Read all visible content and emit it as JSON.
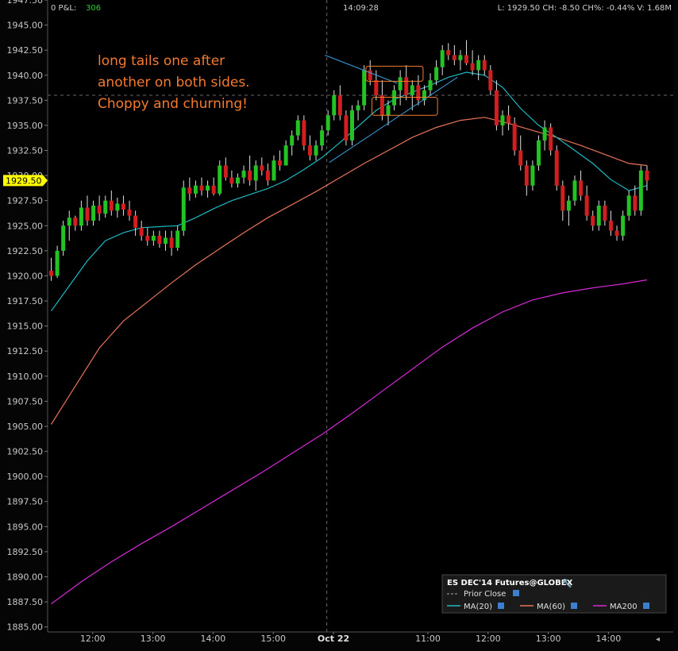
{
  "header": {
    "pnl_label": "0 P&L:",
    "pnl_value": "306",
    "time": "14:09:28",
    "quote": "L: 1929.50 CH: -8.50   CH%: -0.44% V: 1.68M"
  },
  "colors": {
    "background": "#050505",
    "up_candle": "#22c322",
    "down_candle": "#d21e1e",
    "wick": "#e0e0e0",
    "ma20": "#1fb8c0",
    "ma60": "#e8735a",
    "ma200": "#d62ad6",
    "annotation": "#f47a2e",
    "trend": "#3a9fe0",
    "price_tag": "#ffff00"
  },
  "annotation": {
    "lines": [
      "long tails one after",
      "another on both sides.",
      "Choppy and churning!"
    ]
  },
  "legend": {
    "title": "ES DEC'14 Futures@GLOBEX",
    "prior_close": "Prior Close",
    "ma20": "MA(20)",
    "ma60": "MA(60)",
    "ma200": "MA200"
  },
  "chart_data": {
    "type": "candlestick",
    "title": "",
    "xlabel": "",
    "ylabel": "",
    "ylim": [
      1884.5,
      1947.5
    ],
    "y_ticks": [
      "1947.50",
      "1945.00",
      "1942.50",
      "1940.00",
      "1937.50",
      "1935.00",
      "1932.50",
      "1930.00",
      "1927.50",
      "1925.00",
      "1922.50",
      "1920.00",
      "1917.50",
      "1915.00",
      "1912.50",
      "1910.00",
      "1907.50",
      "1905.00",
      "1902.50",
      "1900.00",
      "1897.50",
      "1895.00",
      "1892.50",
      "1890.00",
      "1887.50",
      "1885.00"
    ],
    "x_ticks": [
      {
        "label": "12:00",
        "bar": 6.9
      },
      {
        "label": "13:00",
        "bar": 16.9
      },
      {
        "label": "14:00",
        "bar": 26.9
      },
      {
        "label": "15:00",
        "bar": 36.9
      },
      {
        "label": "Oct 22",
        "bar": 46.9,
        "bold": true
      },
      {
        "label": "11:00",
        "bar": 62.6
      },
      {
        "label": "12:00",
        "bar": 72.6
      },
      {
        "label": "13:00",
        "bar": 82.6
      },
      {
        "label": "14:00",
        "bar": 92.6
      }
    ],
    "last_price": 1929.5,
    "prior_close": 1938.0,
    "session_divider_bar": 45.8,
    "candles": [
      [
        1920.5,
        1921.8,
        1919.5,
        1920.0
      ],
      [
        1920.0,
        1923.0,
        1919.8,
        1922.5
      ],
      [
        1922.5,
        1925.5,
        1922.0,
        1925.0
      ],
      [
        1925.0,
        1926.5,
        1923.5,
        1925.8
      ],
      [
        1925.8,
        1926.0,
        1924.5,
        1925.0
      ],
      [
        1925.0,
        1927.5,
        1924.5,
        1926.8
      ],
      [
        1926.8,
        1928.0,
        1925.0,
        1925.5
      ],
      [
        1925.5,
        1927.5,
        1925.0,
        1927.0
      ],
      [
        1927.0,
        1928.0,
        1925.5,
        1926.2
      ],
      [
        1926.2,
        1928.0,
        1925.8,
        1927.5
      ],
      [
        1927.5,
        1928.5,
        1926.0,
        1926.5
      ],
      [
        1926.5,
        1927.8,
        1925.8,
        1927.2
      ],
      [
        1927.2,
        1928.0,
        1926.0,
        1926.6
      ],
      [
        1926.6,
        1927.5,
        1925.5,
        1926.0
      ],
      [
        1926.0,
        1926.5,
        1924.0,
        1924.8
      ],
      [
        1924.8,
        1925.5,
        1923.5,
        1924.0
      ],
      [
        1924.0,
        1924.8,
        1923.0,
        1923.5
      ],
      [
        1923.5,
        1924.5,
        1923.0,
        1924.0
      ],
      [
        1924.0,
        1924.5,
        1922.8,
        1923.2
      ],
      [
        1923.2,
        1924.5,
        1922.5,
        1923.8
      ],
      [
        1923.8,
        1924.5,
        1922.0,
        1922.8
      ],
      [
        1922.8,
        1925.0,
        1922.5,
        1924.5
      ],
      [
        1924.5,
        1929.5,
        1924.0,
        1928.8
      ],
      [
        1928.8,
        1929.8,
        1927.5,
        1928.2
      ],
      [
        1928.2,
        1929.5,
        1927.8,
        1929.0
      ],
      [
        1929.0,
        1929.8,
        1928.0,
        1928.5
      ],
      [
        1928.5,
        1929.5,
        1927.8,
        1929.0
      ],
      [
        1929.0,
        1929.8,
        1928.0,
        1928.2
      ],
      [
        1928.2,
        1931.5,
        1928.0,
        1931.0
      ],
      [
        1931.0,
        1931.8,
        1929.5,
        1929.8
      ],
      [
        1929.8,
        1930.5,
        1928.8,
        1929.2
      ],
      [
        1929.2,
        1930.2,
        1928.8,
        1929.8
      ],
      [
        1929.8,
        1931.0,
        1929.2,
        1930.5
      ],
      [
        1930.5,
        1932.0,
        1929.0,
        1929.5
      ],
      [
        1929.5,
        1931.5,
        1928.5,
        1931.0
      ],
      [
        1931.0,
        1931.8,
        1930.0,
        1930.5
      ],
      [
        1930.5,
        1931.2,
        1929.0,
        1929.5
      ],
      [
        1929.5,
        1932.0,
        1929.5,
        1931.5
      ],
      [
        1931.5,
        1932.5,
        1930.5,
        1931.0
      ],
      [
        1931.0,
        1933.5,
        1931.0,
        1933.0
      ],
      [
        1933.0,
        1934.5,
        1932.0,
        1934.0
      ],
      [
        1934.0,
        1936.0,
        1933.5,
        1935.5
      ],
      [
        1935.5,
        1936.0,
        1932.5,
        1933.0
      ],
      [
        1933.0,
        1934.0,
        1931.5,
        1932.0
      ],
      [
        1932.0,
        1933.5,
        1931.5,
        1933.0
      ],
      [
        1933.0,
        1935.0,
        1932.5,
        1934.5
      ],
      [
        1934.5,
        1936.5,
        1934.0,
        1936.0
      ],
      [
        1936.0,
        1938.5,
        1935.5,
        1938.0
      ],
      [
        1938.0,
        1939.0,
        1935.5,
        1936.0
      ],
      [
        1936.0,
        1936.5,
        1933.0,
        1933.5
      ],
      [
        1933.5,
        1937.0,
        1933.0,
        1936.5
      ],
      [
        1936.5,
        1937.5,
        1935.5,
        1937.0
      ],
      [
        1937.0,
        1941.0,
        1936.5,
        1940.5
      ],
      [
        1940.5,
        1941.5,
        1939.0,
        1939.5
      ],
      [
        1939.5,
        1940.5,
        1937.5,
        1938.0
      ],
      [
        1938.0,
        1939.5,
        1935.5,
        1936.0
      ],
      [
        1936.0,
        1937.5,
        1935.0,
        1937.0
      ],
      [
        1937.0,
        1939.0,
        1936.5,
        1938.5
      ],
      [
        1938.5,
        1940.5,
        1937.0,
        1939.8
      ],
      [
        1939.8,
        1941.0,
        1937.5,
        1938.0
      ],
      [
        1938.0,
        1939.5,
        1936.5,
        1939.0
      ],
      [
        1939.0,
        1940.0,
        1937.0,
        1937.5
      ],
      [
        1937.5,
        1939.0,
        1937.0,
        1938.5
      ],
      [
        1938.5,
        1940.2,
        1938.0,
        1939.5
      ],
      [
        1939.5,
        1941.5,
        1939.0,
        1940.8
      ],
      [
        1940.8,
        1943.0,
        1940.0,
        1942.5
      ],
      [
        1942.5,
        1943.2,
        1941.5,
        1942.0
      ],
      [
        1942.0,
        1943.0,
        1941.0,
        1941.5
      ],
      [
        1941.5,
        1942.5,
        1940.5,
        1942.0
      ],
      [
        1942.0,
        1943.5,
        1941.0,
        1941.2
      ],
      [
        1941.2,
        1942.5,
        1940.0,
        1940.5
      ],
      [
        1940.5,
        1942.0,
        1939.5,
        1941.5
      ],
      [
        1941.5,
        1942.0,
        1940.0,
        1940.5
      ],
      [
        1940.5,
        1941.0,
        1938.0,
        1938.5
      ],
      [
        1938.5,
        1939.5,
        1934.5,
        1935.0
      ],
      [
        1935.0,
        1936.5,
        1934.0,
        1936.0
      ],
      [
        1936.0,
        1937.0,
        1934.5,
        1935.2
      ],
      [
        1935.2,
        1935.8,
        1932.0,
        1932.5
      ],
      [
        1932.5,
        1934.0,
        1930.5,
        1931.0
      ],
      [
        1931.0,
        1931.5,
        1928.0,
        1929.0
      ],
      [
        1929.0,
        1931.5,
        1928.5,
        1931.0
      ],
      [
        1931.0,
        1934.0,
        1930.5,
        1933.5
      ],
      [
        1933.5,
        1935.5,
        1932.5,
        1934.8
      ],
      [
        1934.8,
        1935.2,
        1932.0,
        1932.5
      ],
      [
        1932.5,
        1933.0,
        1928.5,
        1929.0
      ],
      [
        1929.0,
        1929.5,
        1925.5,
        1926.5
      ],
      [
        1926.5,
        1928.0,
        1925.0,
        1927.5
      ],
      [
        1927.5,
        1930.0,
        1927.0,
        1929.5
      ],
      [
        1929.5,
        1930.5,
        1927.5,
        1928.0
      ],
      [
        1928.0,
        1929.0,
        1925.5,
        1926.0
      ],
      [
        1926.0,
        1926.5,
        1924.5,
        1925.0
      ],
      [
        1925.0,
        1927.5,
        1924.5,
        1927.0
      ],
      [
        1927.0,
        1927.5,
        1925.0,
        1925.5
      ],
      [
        1925.5,
        1926.5,
        1924.0,
        1924.5
      ],
      [
        1924.5,
        1925.0,
        1923.5,
        1924.0
      ],
      [
        1924.0,
        1926.5,
        1923.5,
        1926.0
      ],
      [
        1926.0,
        1928.5,
        1925.5,
        1928.0
      ],
      [
        1928.0,
        1929.0,
        1926.0,
        1926.5
      ],
      [
        1926.5,
        1931.0,
        1926.0,
        1930.5
      ],
      [
        1930.5,
        1931.0,
        1928.5,
        1929.5
      ]
    ],
    "series": [
      {
        "name": "MA(20)",
        "bars": [
          0,
          3,
          6,
          9,
          12,
          15,
          18,
          21,
          24,
          27,
          30,
          33,
          36,
          39,
          42,
          45,
          48,
          51,
          54,
          57,
          60,
          63,
          66,
          69,
          72,
          75,
          78,
          81,
          84,
          87,
          90,
          93,
          96,
          99
        ],
        "values": [
          1916.5,
          1919.0,
          1921.5,
          1923.5,
          1924.3,
          1924.8,
          1924.9,
          1925.0,
          1925.8,
          1926.7,
          1927.5,
          1928.1,
          1928.7,
          1929.5,
          1930.6,
          1931.8,
          1933.3,
          1934.9,
          1936.5,
          1937.6,
          1938.3,
          1939.0,
          1939.8,
          1940.3,
          1940.0,
          1938.8,
          1936.7,
          1935.0,
          1933.8,
          1932.5,
          1931.2,
          1929.6,
          1928.5,
          1929.0
        ]
      },
      {
        "name": "MA(60)",
        "bars": [
          0,
          4,
          8,
          12,
          16,
          20,
          24,
          28,
          32,
          36,
          40,
          44,
          48,
          52,
          56,
          60,
          64,
          68,
          72,
          76,
          80,
          84,
          88,
          92,
          96,
          99
        ],
        "values": [
          1905.2,
          1909.0,
          1912.8,
          1915.5,
          1917.4,
          1919.3,
          1921.1,
          1922.7,
          1924.3,
          1925.8,
          1927.1,
          1928.4,
          1929.8,
          1931.2,
          1932.5,
          1933.8,
          1934.8,
          1935.5,
          1935.8,
          1935.2,
          1934.5,
          1933.8,
          1933.0,
          1932.1,
          1931.2,
          1931.0
        ]
      },
      {
        "name": "MA200",
        "bars": [
          0,
          5,
          10,
          15,
          20,
          25,
          30,
          35,
          40,
          45,
          50,
          55,
          60,
          65,
          70,
          75,
          80,
          85,
          90,
          95,
          99
        ],
        "values": [
          1887.3,
          1889.5,
          1891.5,
          1893.3,
          1895.0,
          1896.8,
          1898.6,
          1900.4,
          1902.3,
          1904.2,
          1906.3,
          1908.5,
          1910.7,
          1912.9,
          1914.8,
          1916.4,
          1917.6,
          1918.3,
          1918.8,
          1919.2,
          1919.6
        ]
      }
    ]
  }
}
